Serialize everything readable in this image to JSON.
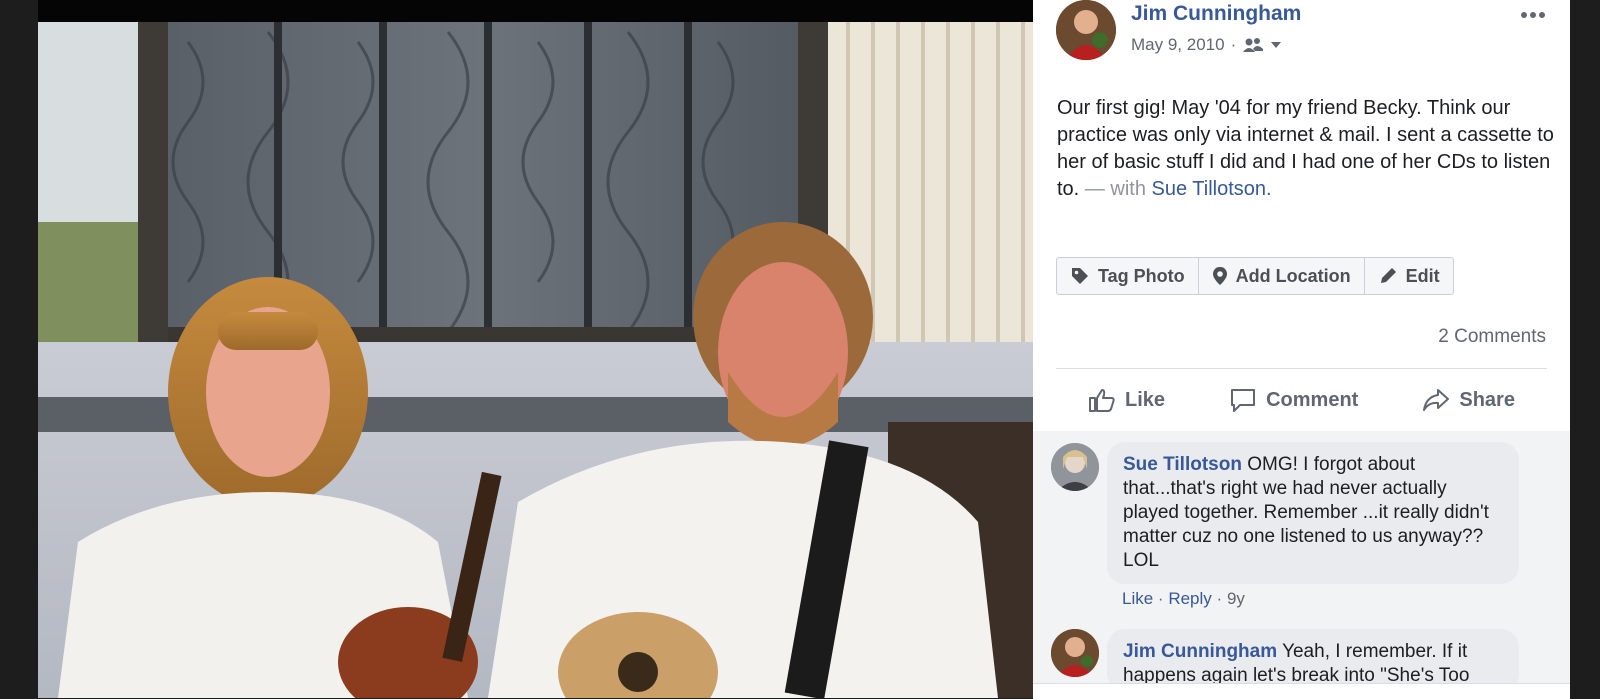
{
  "post": {
    "author": "Jim Cunningham",
    "date": "May 9, 2010",
    "date_separator": "·",
    "audience_icon": "friends-icon",
    "caption": "Our first gig! May '04 for my friend Becky. Think our practice was only via internet & mail. I sent a cassette to her of basic stuff I did and I had one of her CDs to listen to.",
    "with_text": "— with",
    "tagged_person": "Sue Tillotson."
  },
  "photo_actions": {
    "tag_photo": "Tag Photo",
    "add_location": "Add Location",
    "edit": "Edit"
  },
  "comments_summary": "2 Comments",
  "reactions": {
    "like": "Like",
    "comment": "Comment",
    "share": "Share"
  },
  "comments": [
    {
      "author": "Sue Tillotson",
      "text": "OMG! I forgot about that...that's right we had never actually played together. Remember ...it really didn't matter cuz no one listened to us anyway?? LOL",
      "like": "Like",
      "reply": "Reply",
      "sep": "·",
      "age": "9y"
    },
    {
      "author": "Jim Cunningham",
      "text": "Yeah, I remember. If it happens again let's break into \"She's Too"
    }
  ],
  "colors": {
    "link_blue": "#385898",
    "meta_gray": "#606770",
    "bubble_bg": "#e9ebee"
  }
}
